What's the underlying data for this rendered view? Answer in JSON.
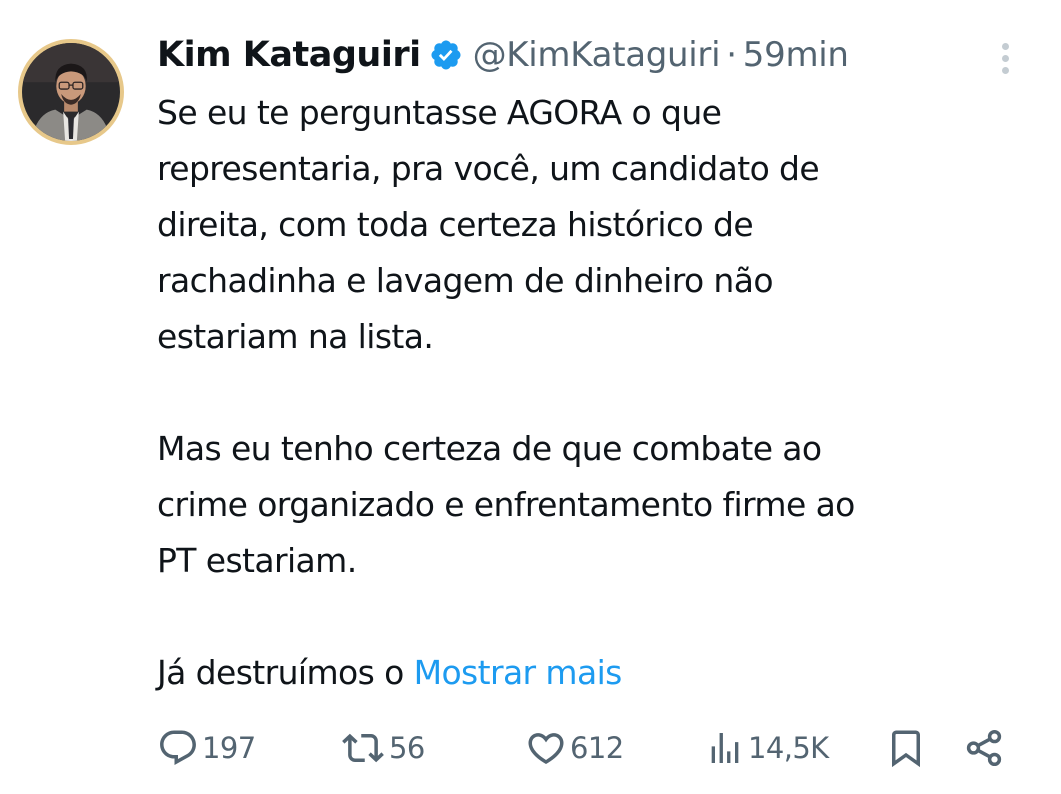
{
  "tweet": {
    "author": {
      "display_name": "Kim Kataguiri",
      "handle": "@KimKataguiri",
      "verified": true,
      "avatar_icon": "profile-photo"
    },
    "separator": "·",
    "time": "59min",
    "text": {
      "paragraph1": "Se eu te perguntasse AGORA o que\nrepresentaria, pra você, um candidato de\ndireita, com toda certeza histórico de\nrachadinha e lavagem de dinheiro não\nestariam na lista.",
      "paragraph2": "Mas eu tenho certeza de que combate ao\ncrime organizado e enfrentamento firme ao\nPT estariam.",
      "paragraph3_start": "Já destruímos o ",
      "show_more": "Mostrar mais"
    },
    "actions": {
      "replies": "197",
      "retweets": "56",
      "likes": "612",
      "views": "14,5K"
    }
  },
  "icons": {
    "more": "more-vertical-icon",
    "verified": "verified-badge-icon",
    "reply": "reply-icon",
    "retweet": "retweet-icon",
    "like": "heart-icon",
    "views": "views-chart-icon",
    "bookmark": "bookmark-icon",
    "share": "share-icon"
  },
  "colors": {
    "text_primary": "#0f1419",
    "text_secondary": "#536471",
    "link": "#1d9bf0",
    "verified": "#1d9bf0",
    "more_dots": "#c4ccd2"
  }
}
